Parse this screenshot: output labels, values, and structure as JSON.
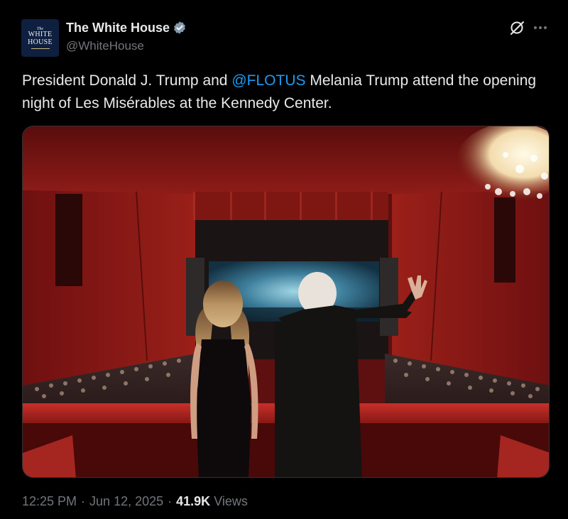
{
  "account": {
    "display_name": "The White House",
    "handle": "@WhiteHouse",
    "verified": true,
    "avatar": {
      "line_the": "The",
      "line_1": "WHITE",
      "line_2": "HOUSE"
    }
  },
  "tweet": {
    "text_before_mention": "President Donald J. Trump and ",
    "mention": "@FLOTUS",
    "text_after_mention": " Melania Trump attend the opening night of Les Misérables at the Kennedy Center."
  },
  "meta": {
    "time": "12:25 PM",
    "separator": "·",
    "date": "Jun 12, 2025",
    "views_count": "41.9K",
    "views_label": "Views"
  },
  "icons": {
    "verified": "verified-badge-icon",
    "grok": "grok-icon",
    "more": "more-options-icon"
  },
  "colors": {
    "background": "#000000",
    "text_primary": "#e7e9ea",
    "text_secondary": "#71767b",
    "link": "#1d9bf0",
    "verified_badge": "#829aab",
    "theater_red": "#8b1a1a"
  }
}
